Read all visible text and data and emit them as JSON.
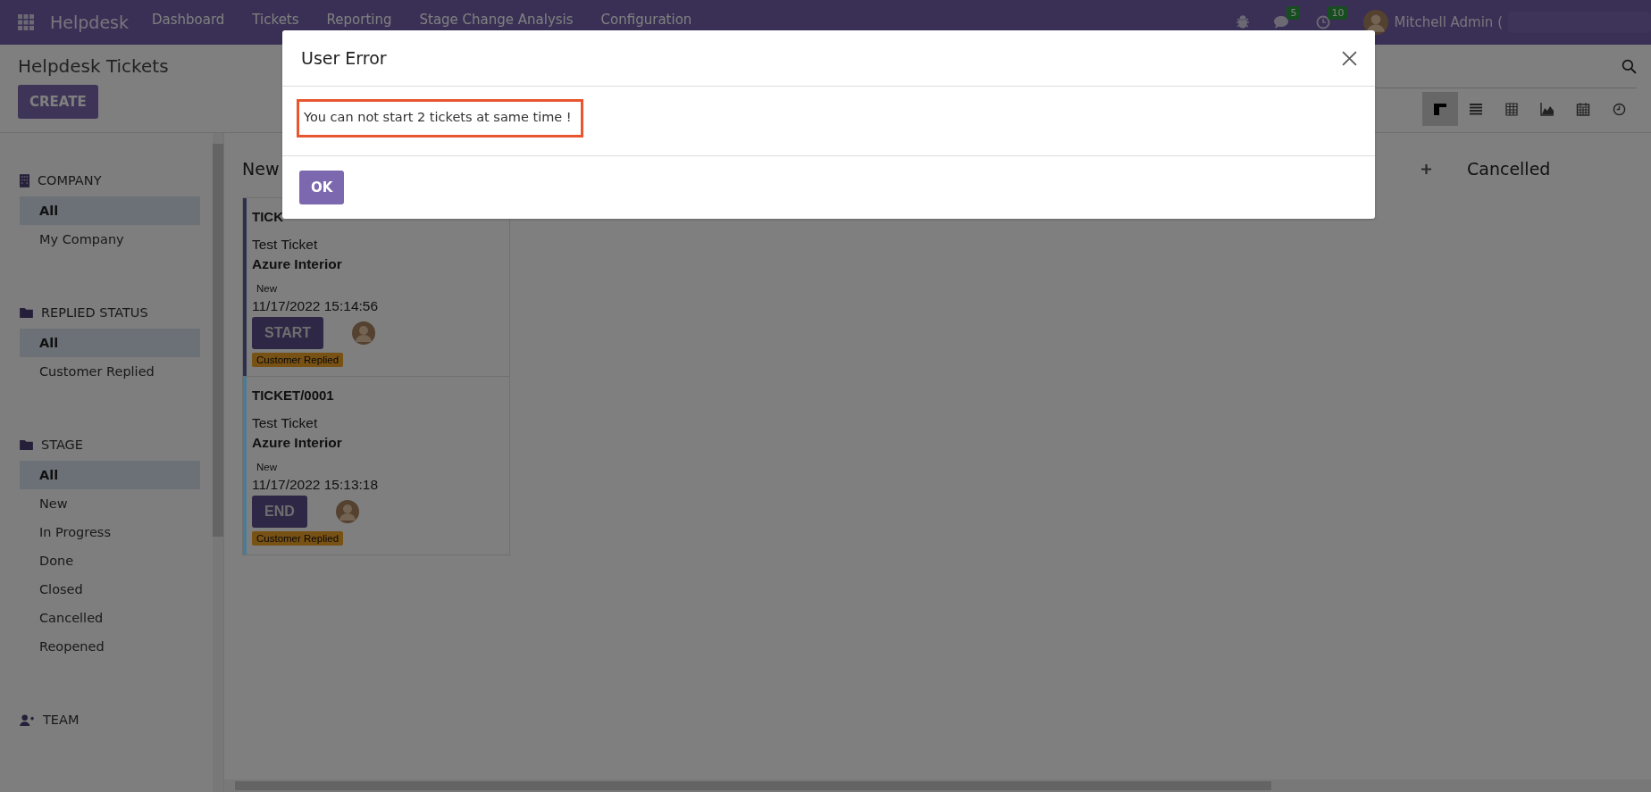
{
  "navbar": {
    "app_name": "Helpdesk",
    "menus": [
      "Dashboard",
      "Tickets",
      "Reporting",
      "Stage Change Analysis",
      "Configuration"
    ],
    "chat_count": "5",
    "activity_count": "10",
    "user": "Mitchell Admin ("
  },
  "control_panel": {
    "title": "Helpdesk Tickets",
    "create_button": "CREATE",
    "views": [
      {
        "selected": true
      },
      {
        "selected": false
      },
      {
        "selected": false
      },
      {
        "selected": false
      },
      {
        "selected": false
      },
      {
        "selected": false
      }
    ]
  },
  "sidebar": {
    "sections": [
      {
        "title": "COMPANY",
        "items": [
          {
            "label": "All",
            "selected": true
          },
          {
            "label": "My Company",
            "selected": false
          }
        ]
      },
      {
        "title": "REPLIED STATUS",
        "items": [
          {
            "label": "All",
            "selected": true
          },
          {
            "label": "Customer Replied",
            "selected": false
          }
        ]
      },
      {
        "title": "STAGE",
        "items": [
          {
            "label": "All",
            "selected": true
          },
          {
            "label": "New",
            "selected": false
          },
          {
            "label": "In Progress",
            "selected": false
          },
          {
            "label": "Done",
            "selected": false
          },
          {
            "label": "Closed",
            "selected": false
          },
          {
            "label": "Cancelled",
            "selected": false
          },
          {
            "label": "Reopened",
            "selected": false
          }
        ]
      },
      {
        "title": "TEAM"
      }
    ]
  },
  "kanban": {
    "columns": [
      {
        "title": "New",
        "cards": [
          {
            "reference": "TICK",
            "name": "Test Ticket",
            "customer": "Azure Interior",
            "stage": "New",
            "date": "11/17/2022 15:14:56",
            "button": "START",
            "tag": "Customer Replied",
            "color": "#2d2f4d"
          },
          {
            "reference": "TICKET/0001",
            "name": "Test Ticket",
            "customer": "Azure Interior",
            "stage": "New",
            "date": "11/17/2022 15:13:18",
            "button": "END",
            "tag": "Customer Replied",
            "color": "#4b7b97"
          }
        ]
      },
      {
        "title": "Cancelled"
      }
    ]
  },
  "dialog": {
    "title": "User Error",
    "message": "You can not start 2 tickets at same time !",
    "ok_button": "OK"
  }
}
